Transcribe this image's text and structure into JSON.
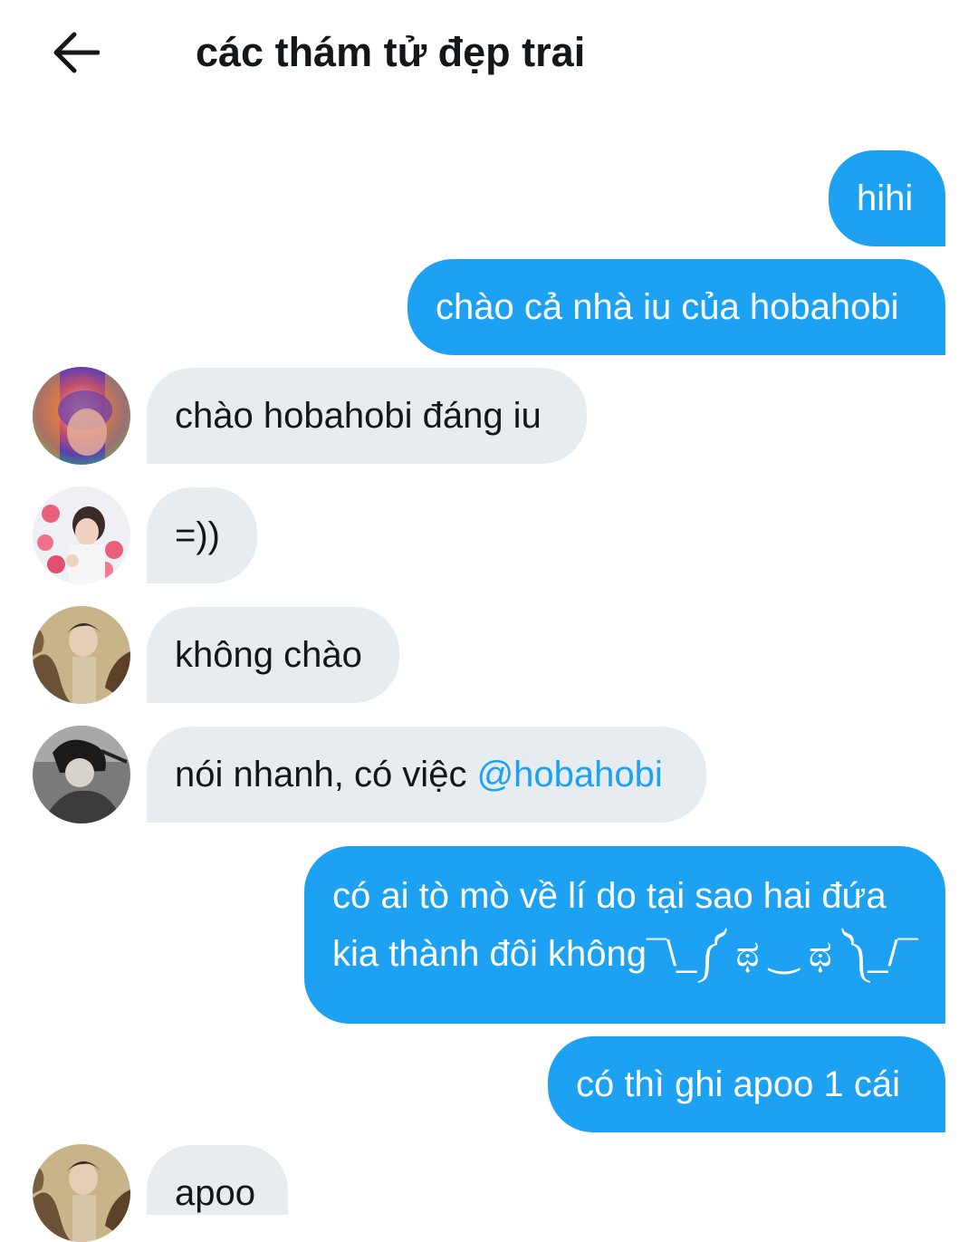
{
  "header": {
    "title": "các thám tử đẹp trai",
    "back_icon": "arrow-left-icon"
  },
  "messages": [
    {
      "side": "out",
      "text": "hihi"
    },
    {
      "side": "out",
      "text": "chào cả nhà iu của hobahobi"
    },
    {
      "side": "in",
      "avatar": "avatar-rainbow",
      "text": "chào hobahobi đáng iu"
    },
    {
      "side": "in",
      "avatar": "avatar-hearts",
      "text": "=))"
    },
    {
      "side": "in",
      "avatar": "avatar-fur",
      "text": "không chào"
    },
    {
      "side": "in",
      "avatar": "avatar-dark",
      "text": "nói nhanh, có việc ",
      "mention": "@hobahobi"
    },
    {
      "side": "out",
      "lines": [
        "có ai tò mò về lí do tại sao hai đứa",
        "kia thành đôi không¯\\_༼ ಥ ‿ ಥ ༽_/¯"
      ]
    },
    {
      "side": "out",
      "text": "có thì ghi apoo 1 cái"
    },
    {
      "side": "in",
      "avatar": "avatar-fur",
      "text": "apoo"
    }
  ],
  "colors": {
    "outgoing_bubble": "#1da1f2",
    "incoming_bubble": "#e6ecf0",
    "mention": "#1da1f2"
  }
}
